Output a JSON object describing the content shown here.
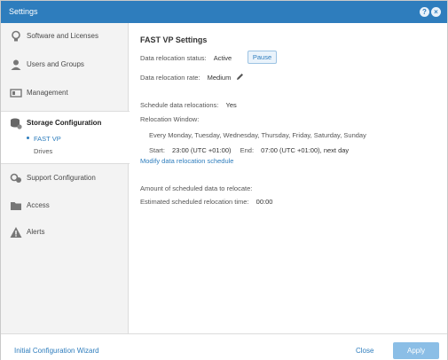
{
  "window": {
    "title": "Settings"
  },
  "titlebar": {
    "help_glyph": "?",
    "close_glyph": "×"
  },
  "sidebar": {
    "items": [
      {
        "label": "Software and Licenses",
        "icon": "lightbulb-icon"
      },
      {
        "label": "Users and Groups",
        "icon": "user-icon"
      },
      {
        "label": "Management",
        "icon": "management-icon"
      },
      {
        "label": "Storage Configuration",
        "icon": "storage-icon",
        "active": true,
        "children": [
          {
            "label": "FAST VP",
            "active": true
          },
          {
            "label": "Drives"
          }
        ]
      },
      {
        "label": "Support Configuration",
        "icon": "support-icon"
      },
      {
        "label": "Access",
        "icon": "folder-icon"
      },
      {
        "label": "Alerts",
        "icon": "alert-icon"
      }
    ]
  },
  "main": {
    "heading": "FAST VP Settings",
    "relocation_status_label": "Data relocation status:",
    "relocation_status_value": "Active",
    "pause_label": "Pause",
    "relocation_rate_label": "Data relocation rate:",
    "relocation_rate_value": "Medium",
    "schedule_label": "Schedule data relocations:",
    "schedule_value": "Yes",
    "window_label": "Relocation Window:",
    "window_days": "Every Monday, Tuesday, Wednesday, Thursday, Friday, Saturday, Sunday",
    "start_label": "Start:",
    "start_value": "23:00 (UTC +01:00)",
    "end_label": "End:",
    "end_value": "07:00 (UTC +01:00), next day",
    "modify_link": "Modify data relocation schedule",
    "amount_label": "Amount of scheduled data to relocate:",
    "estimated_label": "Estimated scheduled relocation time:",
    "estimated_value": "00:00"
  },
  "footer": {
    "wizard_link": "Initial Configuration Wizard",
    "close_label": "Close",
    "apply_label": "Apply"
  },
  "colors": {
    "accent": "#2e7dbd",
    "sidebar_bg": "#f3f3f3",
    "apply_disabled": "#8bbee6"
  }
}
